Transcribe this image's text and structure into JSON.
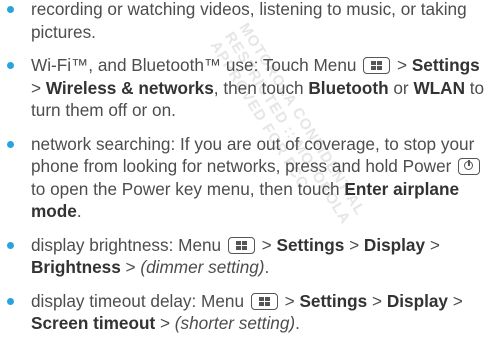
{
  "watermark": [
    "MOTOROLA CONFIDENTIAL",
    "RESTRICTED :: MOTOROLA",
    "APPROVED FOR FCC"
  ],
  "items": [
    {
      "text": "recording or watching videos, listening to music, or taking pictures."
    },
    {
      "p1": "Wi-Fi™, and Bluetooth™ use: Touch Menu",
      "p2": " > ",
      "settings": "Settings",
      "p3": " > ",
      "wireless": "Wireless & networks",
      "p4": ", then touch ",
      "bluetooth": "Bluetooth",
      "p5": " or ",
      "wlan": "WLAN",
      "p6": " to turn them off or on."
    },
    {
      "p1": "network searching: If you are out of coverage, to stop your phone from looking for networks, press and hold Power",
      "p2": " to open the Power key menu, then touch ",
      "airplane": "Enter airplane mode",
      "p3": "."
    },
    {
      "p1": "display brightness: Menu",
      "p2": " > ",
      "settings": "Settings",
      "p3": " > ",
      "display": "Display",
      "p4": " > ",
      "brightness": "Brightness",
      "p5": " > ",
      "setting": "(dimmer setting)",
      "p6": "."
    },
    {
      "p1": "display timeout delay: Menu",
      "p2": " > ",
      "settings": "Settings",
      "p3": " > ",
      "display": "Display",
      "p4": " > ",
      "timeout": "Screen timeout",
      "p5": " > ",
      "setting": "(shorter setting)",
      "p6": "."
    }
  ],
  "icons": {
    "menu": "menu-key-icon",
    "power": "power-key-icon"
  },
  "colors": {
    "bullet": "#29a3dd",
    "text": "#4d4d4d",
    "watermark": "#e6e6e6"
  }
}
